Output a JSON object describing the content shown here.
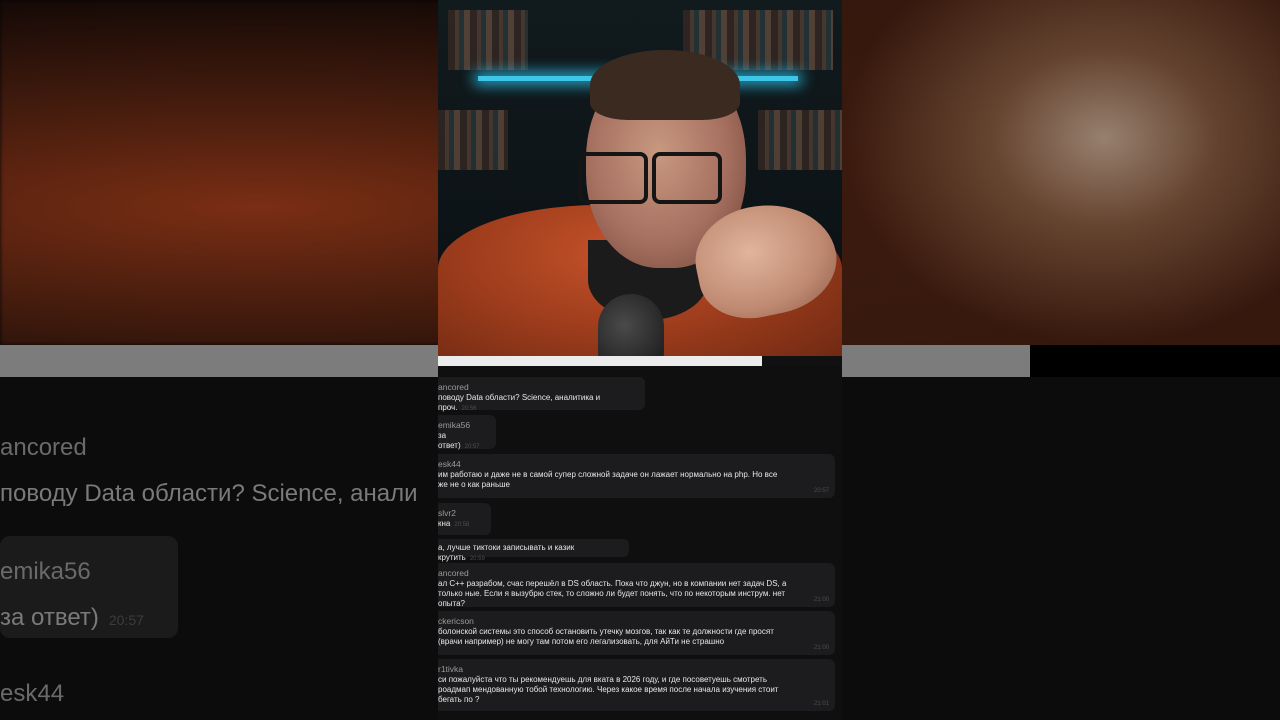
{
  "background": {
    "user_1": "ancored",
    "text_1": "поводу Data области? Science, анали",
    "user_2": "emika56",
    "text_2": "за ответ)",
    "time_2": "20:57",
    "user_3": "esk44"
  },
  "chat": {
    "messages": [
      {
        "user": "ancored",
        "text": "поводу Data области? Science, аналитика и проч.",
        "time": "20:56"
      },
      {
        "user": "emika56",
        "text": "за ответ)",
        "time": "20:57"
      },
      {
        "user": "esk44",
        "text": "им работаю и даже не в самой супер сложной задаче он лажает нормально на php. Но все же не о как раньше",
        "time": "20:57"
      },
      {
        "user": "slvr2",
        "text": "кна",
        "time": "20:58"
      },
      {
        "user": "",
        "text": "а, лучше тиктоки записывать и казик крутить",
        "time": "20:59"
      },
      {
        "user": "ancored",
        "text": "ал C++ разрабом, счас перешёл в DS область. Пока что джун, но в компании нет задач DS, а только ные. Если я вызубрю стек, то сложно ли будет понять, что по некоторым инструм. нет опыта?",
        "time": "21:00"
      },
      {
        "user": "ckericson",
        "text": "болонской системы это способ остановить утечку мозгов, так как те должности где просят (врачи например) не могу там потом его легализовать, для АйТи не страшно",
        "time": "21:00"
      },
      {
        "user": "r1tivka",
        "text": "си пожалуйста что ты рекомендуешь для вката в 2026 году, и где посоветуешь смотреть роадмап мендованную тобой технологию. Через какое время после начала изучения стоит бегать по ?",
        "time": "21:01"
      }
    ]
  },
  "colors": {
    "chat_bg": "#0f0f0f",
    "bubble_bg": "#1c1c1e",
    "username": "#9a9a9a",
    "message_text": "#e8e8e8",
    "hoodie": "#b2451f",
    "shelf_glow": "#3ec6e8"
  }
}
